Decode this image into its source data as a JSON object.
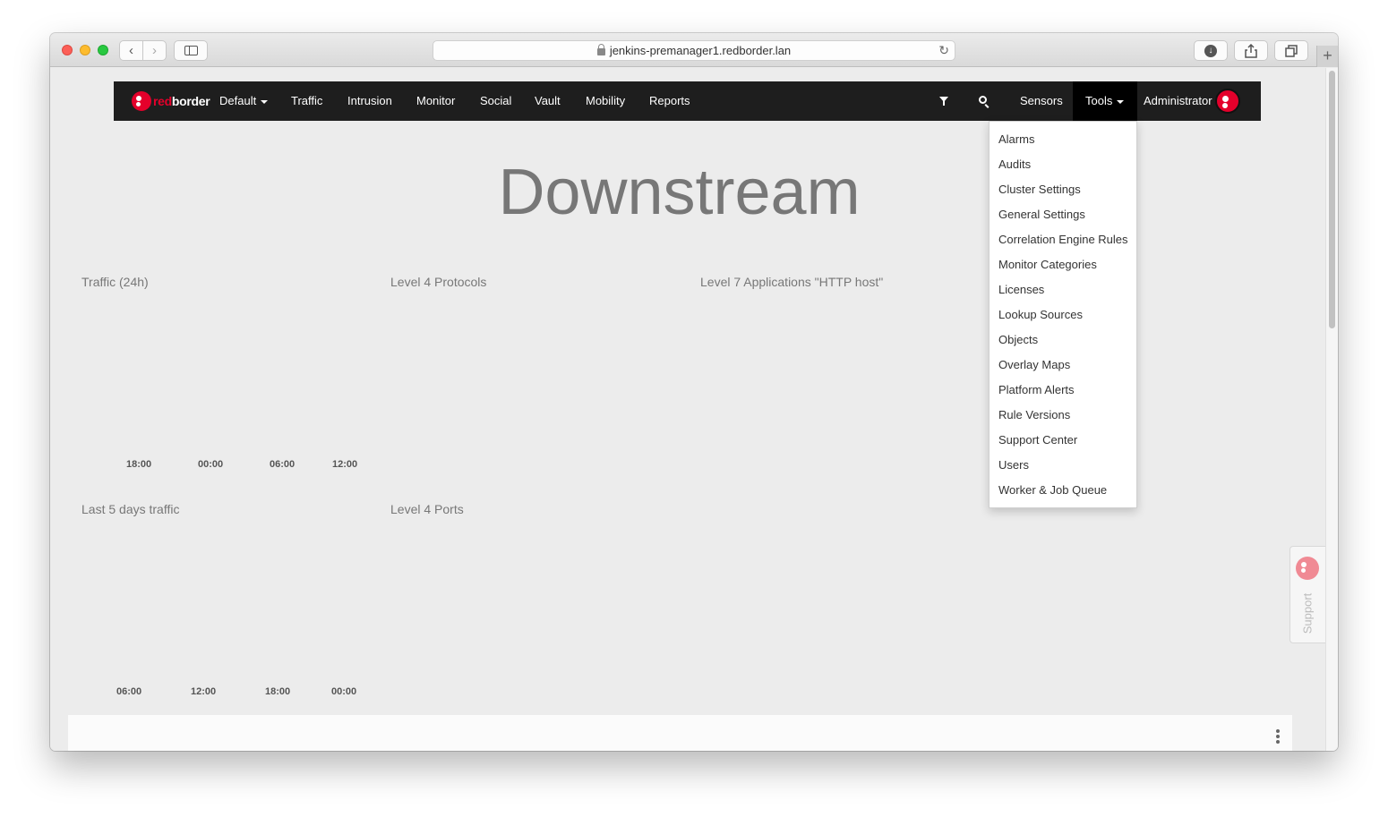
{
  "browser": {
    "url": "jenkins-premanager1.redborder.lan",
    "back": "‹",
    "forward": "›",
    "reload": "↻",
    "new_tab": "+"
  },
  "navbar": {
    "brand_prefix": "red",
    "brand_suffix": "border",
    "domain_selector": "Default",
    "items": [
      "Traffic",
      "Intrusion",
      "Monitor",
      "Social",
      "Vault",
      "Mobility",
      "Reports"
    ],
    "sensors": "Sensors",
    "tools": "Tools",
    "user": "Administrator"
  },
  "page": {
    "title": "Downstream"
  },
  "widgets": [
    {
      "title": "Traffic (24h)",
      "ticks": [
        "18:00",
        "00:00",
        "06:00",
        "12:00"
      ]
    },
    {
      "title": "Level 4 Protocols"
    },
    {
      "title": "Level 7 Applications \"HTTP host\""
    },
    {
      "title": "Last 5 days traffic",
      "ticks": [
        "06:00",
        "12:00",
        "18:00",
        "00:00"
      ]
    },
    {
      "title": "Level 4 Ports"
    }
  ],
  "tools_menu": [
    "Alarms",
    "Audits",
    "Cluster Settings",
    "General Settings",
    "Correlation Engine Rules",
    "Monitor Categories",
    "Licenses",
    "Lookup Sources",
    "Objects",
    "Overlay Maps",
    "Platform Alerts",
    "Rule Versions",
    "Support Center",
    "Users",
    "Worker & Job Queue"
  ],
  "support": {
    "label": "Support"
  },
  "colors": {
    "brand_red": "#e4002b",
    "navbar_bg": "#1e1e1e",
    "page_bg": "#ececec"
  }
}
